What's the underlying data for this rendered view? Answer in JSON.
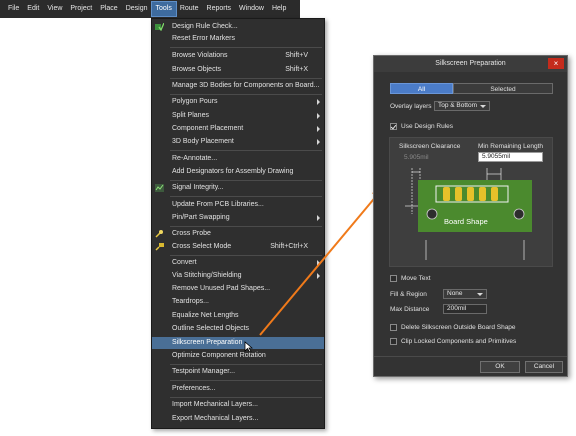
{
  "menubar": {
    "items": [
      {
        "label": "File"
      },
      {
        "label": "Edit"
      },
      {
        "label": "View"
      },
      {
        "label": "Project"
      },
      {
        "label": "Place"
      },
      {
        "label": "Design"
      },
      {
        "label": "Tools"
      },
      {
        "label": "Route"
      },
      {
        "label": "Reports"
      },
      {
        "label": "Window"
      },
      {
        "label": "Help"
      }
    ]
  },
  "tools_menu": {
    "items": [
      {
        "label": "Design Rule Check...",
        "shortcut": "",
        "icon": "design-rule-check-icon"
      },
      {
        "label": "Reset Error Markers",
        "shortcut": ""
      },
      {
        "label": "Browse Violations",
        "shortcut": "Shift+V"
      },
      {
        "label": "Browse Objects",
        "shortcut": "Shift+X"
      },
      {
        "label": "Manage 3D Bodies for Components on Board...",
        "shortcut": ""
      },
      {
        "label": "Polygon Pours",
        "shortcut": ""
      },
      {
        "label": "Split Planes",
        "shortcut": ""
      },
      {
        "label": "Component Placement",
        "shortcut": ""
      },
      {
        "label": "3D Body Placement",
        "shortcut": ""
      },
      {
        "label": "Re-Annotate...",
        "shortcut": ""
      },
      {
        "label": "Add Designators for Assembly Drawing",
        "shortcut": ""
      },
      {
        "label": "Signal Integrity...",
        "shortcut": "",
        "icon": "signal-integrity-icon"
      },
      {
        "label": "Update From PCB Libraries...",
        "shortcut": ""
      },
      {
        "label": "Pin/Part Swapping",
        "shortcut": ""
      },
      {
        "label": "Cross Probe",
        "shortcut": "",
        "icon": "cross-probe-icon"
      },
      {
        "label": "Cross Select Mode",
        "shortcut": "Shift+Ctrl+X",
        "icon": "cross-select-icon"
      },
      {
        "label": "Convert",
        "shortcut": ""
      },
      {
        "label": "Via Stitching/Shielding",
        "shortcut": ""
      },
      {
        "label": "Remove Unused Pad Shapes...",
        "shortcut": ""
      },
      {
        "label": "Teardrops...",
        "shortcut": ""
      },
      {
        "label": "Equalize Net Lengths",
        "shortcut": ""
      },
      {
        "label": "Outline Selected Objects",
        "shortcut": ""
      },
      {
        "label": "Silkscreen Preparation",
        "shortcut": ""
      },
      {
        "label": "Optimize Component Rotation",
        "shortcut": ""
      },
      {
        "label": "Testpoint Manager...",
        "shortcut": ""
      },
      {
        "label": "Preferences...",
        "shortcut": ""
      },
      {
        "label": "Import Mechanical Layers...",
        "shortcut": ""
      },
      {
        "label": "Export Mechanical Layers...",
        "shortcut": ""
      }
    ]
  },
  "dialog": {
    "title": "Silkscreen Preparation",
    "close": "×",
    "tab_all": "All",
    "tab_selected": "Selected",
    "overlay_label": "Overlay layers",
    "overlay_value": "Top & Bottom",
    "use_design_rules": "Use Design Rules",
    "silk_clearance_label": "Silkscreen Clearance",
    "silk_clearance_value": "5.905mil",
    "min_remaining_label": "Min Remaining Length",
    "min_remaining_value": "5.9055mil",
    "board_shape_label": "Board Shape",
    "move_text": "Move Text",
    "fill_region_label": "Fill & Region",
    "fill_region_value": "None",
    "max_distance_label": "Max Distance",
    "max_distance_value": "200mil",
    "delete_outside": "Delete Silkscreen Outside Board Shape",
    "clip_locked": "Clip Locked Components and Primitives",
    "ok": "OK",
    "cancel": "Cancel"
  },
  "colors": {
    "menu_bg": "#2b2b2b",
    "menu_highlight": "#4a6f96",
    "board_green": "#4b8a2e",
    "arrow_orange": "#f07a1a",
    "close_red": "#c42b1c"
  }
}
